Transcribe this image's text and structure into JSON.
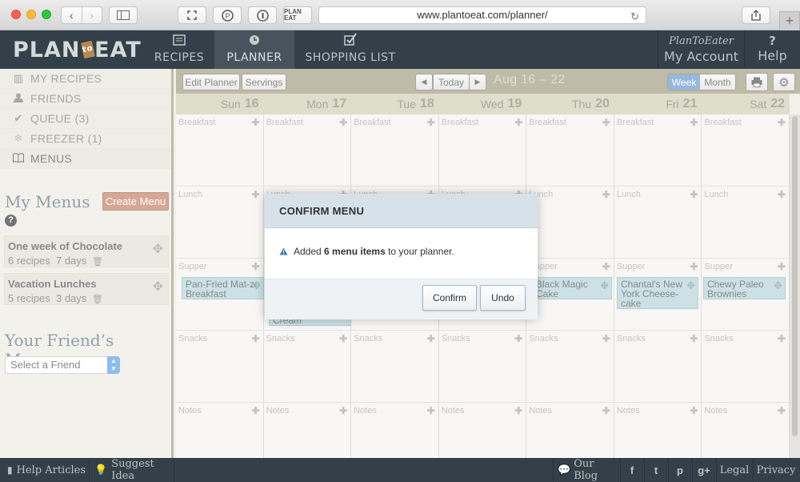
{
  "browser": {
    "url": "www.plantoeat.com/planner/",
    "ext_label": "PLAN EAT"
  },
  "nav": {
    "logo_left": "PLAN",
    "logo_mid": "to",
    "logo_right": "EAT",
    "tabs": [
      {
        "label": "RECIPES",
        "icon": "recipes-icon"
      },
      {
        "label": "PLANNER",
        "icon": "clock-icon"
      },
      {
        "label": "SHOPPING LIST",
        "icon": "checkmark-icon"
      }
    ],
    "account_brand": "PlanToEater",
    "account_label": "My Account",
    "help_label": "Help"
  },
  "sidebar": {
    "items": [
      {
        "label": "MY RECIPES",
        "icon": "book-icon"
      },
      {
        "label": "FRIENDS",
        "icon": "person-icon"
      },
      {
        "label": "QUEUE (3)",
        "icon": "check-icon"
      },
      {
        "label": "FREEZER (1)",
        "icon": "snowflake-icon"
      },
      {
        "label": "MENUS",
        "icon": "open-book-icon"
      }
    ],
    "my_menus_title": "My Menus",
    "create_menu_label": "Create Menu",
    "menus": [
      {
        "name": "One week of Chocolate",
        "recipes": "6 recipes",
        "days": "7 days"
      },
      {
        "name": "Vacation Lunches",
        "recipes": "5 recipes",
        "days": "3 days"
      }
    ],
    "friends_menus_title": "Your Friend’s Menus",
    "select_friend": "Select a Friend"
  },
  "toolbar": {
    "edit_planner": "Edit Planner",
    "servings": "Servings",
    "today": "Today",
    "date_range": "Aug 16 – 22",
    "week": "Week",
    "month": "Month"
  },
  "days": [
    {
      "name": "Sun",
      "date": "16"
    },
    {
      "name": "Mon",
      "date": "17"
    },
    {
      "name": "Tue",
      "date": "18"
    },
    {
      "name": "Wed",
      "date": "19"
    },
    {
      "name": "Thu",
      "date": "20"
    },
    {
      "name": "Fri",
      "date": "21"
    },
    {
      "name": "Sat",
      "date": "22"
    }
  ],
  "meals": [
    "Breakfast",
    "Lunch",
    "Supper",
    "Snacks",
    "Notes"
  ],
  "recipes": {
    "sun": "Pan-Fried Mat-zo Breakfast",
    "mon": "Cream",
    "thu": "Black Magic Cake",
    "fri": "Chantal's New York Cheese-cake",
    "sat": "Chewy Paleo Brownies"
  },
  "modal": {
    "title": "CONFIRM MENU",
    "msg_pre": "Added ",
    "msg_bold": "6 menu items",
    "msg_post": " to your planner.",
    "confirm": "Confirm",
    "undo": "Undo"
  },
  "footer": {
    "help_articles": "Help Articles",
    "suggest_idea": "Suggest Idea",
    "our_blog": "Our Blog",
    "social": [
      "f",
      "t",
      "p",
      "g+"
    ],
    "legal": "Legal",
    "privacy": "Privacy"
  },
  "colors": {
    "nav_bg": "#334049",
    "toolbar_bg": "#8f8b6b",
    "accent_button": "#b86849",
    "recipe_chip": "#a8ccd2",
    "week_active": "#4b86c4"
  }
}
